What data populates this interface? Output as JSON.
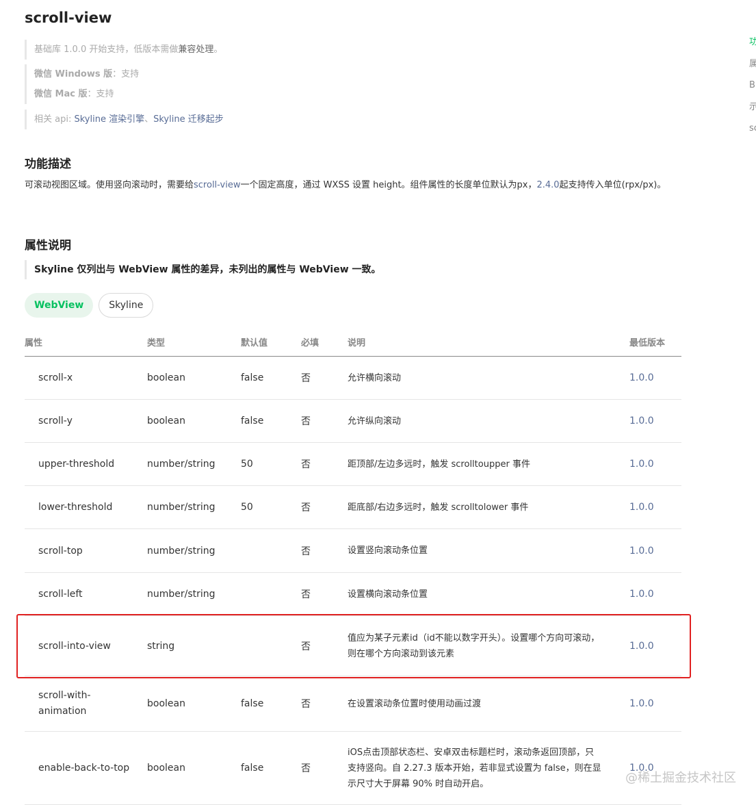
{
  "page": {
    "title": "scroll-view",
    "note1": {
      "prefix": "基础库 1.0.0 开始支持，低版本需做",
      "link": "兼容处理",
      "suffix": "。"
    },
    "note2": {
      "windows_label": "微信 Windows 版",
      "windows_value": "：支持",
      "mac_label": "微信 Mac 版",
      "mac_value": "：支持"
    },
    "note3": {
      "prefix": "相关 api: ",
      "link1": "Skyline 渲染引擎",
      "sep": "、",
      "link2": "Skyline 迁移起步"
    },
    "section1_title": "功能描述",
    "description": {
      "part1": "可滚动视图区域。使用竖向滚动时，需要给",
      "link1": "scroll-view",
      "part2": "一个固定高度，通过 WXSS 设置 height。组件属性的长度单位默认为px，",
      "link2": "2.4.0",
      "part3": "起支持传入单位(rpx/px)。"
    },
    "section2_title": "属性说明",
    "attr_note": "Skyline 仅列出与 WebView 属性的差异，未列出的属性与 WebView 一致。"
  },
  "tabs": [
    {
      "label": "WebView",
      "active": true
    },
    {
      "label": "Skyline",
      "active": false
    }
  ],
  "table": {
    "headers": [
      "属性",
      "类型",
      "默认值",
      "必填",
      "说明",
      "最低版本"
    ],
    "rows": [
      {
        "name": "scroll-x",
        "type": "boolean",
        "default": "false",
        "required": "否",
        "desc": "允许横向滚动",
        "version": "1.0.0"
      },
      {
        "name": "scroll-y",
        "type": "boolean",
        "default": "false",
        "required": "否",
        "desc": "允许纵向滚动",
        "version": "1.0.0"
      },
      {
        "name": "upper-threshold",
        "type": "number/string",
        "default": "50",
        "required": "否",
        "desc": "距顶部/左边多远时，触发 scrolltoupper 事件",
        "version": "1.0.0"
      },
      {
        "name": "lower-threshold",
        "type": "number/string",
        "default": "50",
        "required": "否",
        "desc": "距底部/右边多远时，触发 scrolltolower 事件",
        "version": "1.0.0"
      },
      {
        "name": "scroll-top",
        "type": "number/string",
        "default": "",
        "required": "否",
        "desc": "设置竖向滚动条位置",
        "version": "1.0.0"
      },
      {
        "name": "scroll-left",
        "type": "number/string",
        "default": "",
        "required": "否",
        "desc": "设置横向滚动条位置",
        "version": "1.0.0"
      },
      {
        "name": "scroll-into-view",
        "type": "string",
        "default": "",
        "required": "否",
        "desc": "值应为某子元素id（id不能以数字开头）。设置哪个方向可滚动，则在哪个方向滚动到该元素",
        "version": "1.0.0"
      },
      {
        "name": "scroll-with-animation",
        "type": "boolean",
        "default": "false",
        "required": "否",
        "desc": "在设置滚动条位置时使用动画过渡",
        "version": "1.0.0"
      },
      {
        "name": "enable-back-to-top",
        "type": "boolean",
        "default": "false",
        "required": "否",
        "desc": "iOS点击顶部状态栏、安卓双击标题栏时，滚动条返回顶部，只支持竖向。自 2.27.3 版本开始，若非显式设置为 false，则在显示尺寸大于屏幕 90% 时自动开启。",
        "version": "1.0.0"
      }
    ]
  },
  "toc": [
    "功",
    "属",
    "B",
    "示",
    "sc"
  ],
  "watermark": "@稀土掘金技术社区",
  "colors": {
    "accent_green": "#07c160",
    "link_blue": "#576b95",
    "highlight_red": "#e02020"
  }
}
